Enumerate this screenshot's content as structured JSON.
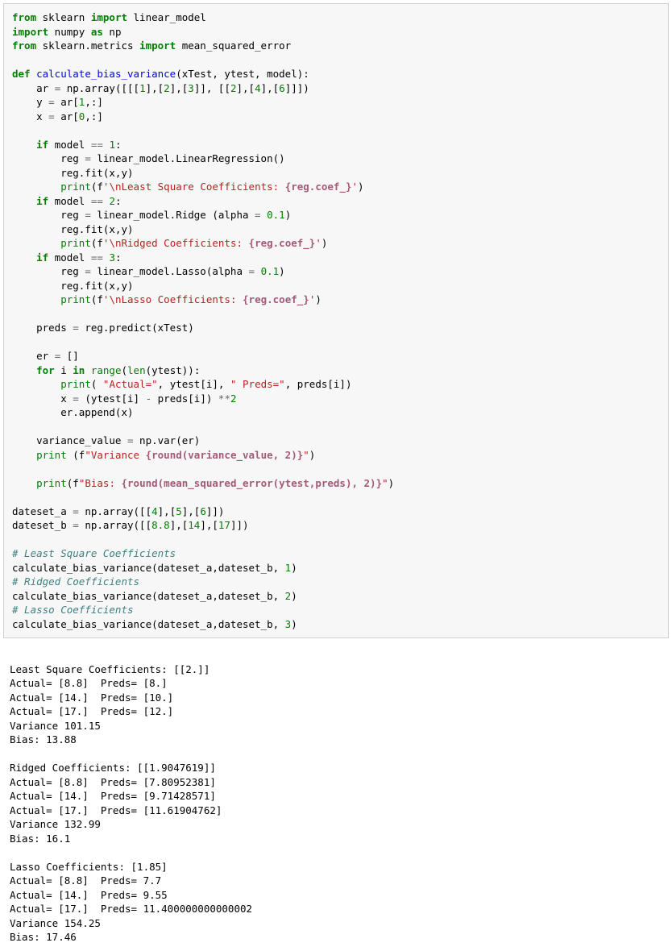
{
  "code": {
    "lines": [
      [
        [
          "kw",
          "from"
        ],
        [
          "n",
          " sklearn "
        ],
        [
          "kw",
          "import"
        ],
        [
          "n",
          " linear_model"
        ]
      ],
      [
        [
          "kw",
          "import"
        ],
        [
          "n",
          " numpy "
        ],
        [
          "kw",
          "as"
        ],
        [
          "n",
          " np"
        ]
      ],
      [
        [
          "kw",
          "from"
        ],
        [
          "n",
          " sklearn.metrics "
        ],
        [
          "kw",
          "import"
        ],
        [
          "n",
          " mean_squared_error"
        ]
      ],
      [],
      [
        [
          "kw",
          "def"
        ],
        [
          "n",
          " "
        ],
        [
          "fn",
          "calculate_bias_variance"
        ],
        [
          "n",
          "(xTest, ytest, model):"
        ]
      ],
      [
        [
          "n",
          "    ar "
        ],
        [
          "op",
          "="
        ],
        [
          "n",
          " np.array([[["
        ],
        [
          "num",
          "1"
        ],
        [
          "n",
          "],["
        ],
        [
          "num",
          "2"
        ],
        [
          "n",
          "],["
        ],
        [
          "num",
          "3"
        ],
        [
          "n",
          "]], [["
        ],
        [
          "num",
          "2"
        ],
        [
          "n",
          "],["
        ],
        [
          "num",
          "4"
        ],
        [
          "n",
          "],["
        ],
        [
          "num",
          "6"
        ],
        [
          "n",
          "]]])"
        ]
      ],
      [
        [
          "n",
          "    y "
        ],
        [
          "op",
          "="
        ],
        [
          "n",
          " ar["
        ],
        [
          "num",
          "1"
        ],
        [
          "n",
          ",:]"
        ]
      ],
      [
        [
          "n",
          "    x "
        ],
        [
          "op",
          "="
        ],
        [
          "n",
          " ar["
        ],
        [
          "num",
          "0"
        ],
        [
          "n",
          ",:]"
        ]
      ],
      [],
      [
        [
          "n",
          "    "
        ],
        [
          "kw",
          "if"
        ],
        [
          "n",
          " model "
        ],
        [
          "op",
          "=="
        ],
        [
          "n",
          " "
        ],
        [
          "num",
          "1"
        ],
        [
          "n",
          ":"
        ]
      ],
      [
        [
          "n",
          "        reg "
        ],
        [
          "op",
          "="
        ],
        [
          "n",
          " linear_model.LinearRegression()"
        ]
      ],
      [
        [
          "n",
          "        reg.fit(x,y)"
        ]
      ],
      [
        [
          "n",
          "        "
        ],
        [
          "bn",
          "print"
        ],
        [
          "n",
          "(f"
        ],
        [
          "s",
          "'\\nLeast Square Coefficients: "
        ],
        [
          "si",
          "{reg.coef_}"
        ],
        [
          "s",
          "'"
        ],
        [
          "n",
          ")"
        ]
      ],
      [
        [
          "n",
          "    "
        ],
        [
          "kw",
          "if"
        ],
        [
          "n",
          " model "
        ],
        [
          "op",
          "=="
        ],
        [
          "n",
          " "
        ],
        [
          "num",
          "2"
        ],
        [
          "n",
          ":"
        ]
      ],
      [
        [
          "n",
          "        reg "
        ],
        [
          "op",
          "="
        ],
        [
          "n",
          " linear_model.Ridge (alpha "
        ],
        [
          "op",
          "="
        ],
        [
          "n",
          " "
        ],
        [
          "num",
          "0.1"
        ],
        [
          "n",
          ")"
        ]
      ],
      [
        [
          "n",
          "        reg.fit(x,y)"
        ]
      ],
      [
        [
          "n",
          "        "
        ],
        [
          "bn",
          "print"
        ],
        [
          "n",
          "(f"
        ],
        [
          "s",
          "'\\nRidged Coefficients: "
        ],
        [
          "si",
          "{reg.coef_}"
        ],
        [
          "s",
          "'"
        ],
        [
          "n",
          ")"
        ]
      ],
      [
        [
          "n",
          "    "
        ],
        [
          "kw",
          "if"
        ],
        [
          "n",
          " model "
        ],
        [
          "op",
          "=="
        ],
        [
          "n",
          " "
        ],
        [
          "num",
          "3"
        ],
        [
          "n",
          ":"
        ]
      ],
      [
        [
          "n",
          "        reg "
        ],
        [
          "op",
          "="
        ],
        [
          "n",
          " linear_model.Lasso(alpha "
        ],
        [
          "op",
          "="
        ],
        [
          "n",
          " "
        ],
        [
          "num",
          "0.1"
        ],
        [
          "n",
          ")"
        ]
      ],
      [
        [
          "n",
          "        reg.fit(x,y)"
        ]
      ],
      [
        [
          "n",
          "        "
        ],
        [
          "bn",
          "print"
        ],
        [
          "n",
          "(f"
        ],
        [
          "s",
          "'\\nLasso Coefficients: "
        ],
        [
          "si",
          "{reg.coef_}"
        ],
        [
          "s",
          "'"
        ],
        [
          "n",
          ")"
        ]
      ],
      [],
      [
        [
          "n",
          "    preds "
        ],
        [
          "op",
          "="
        ],
        [
          "n",
          " reg.predict(xTest)"
        ]
      ],
      [],
      [
        [
          "n",
          "    er "
        ],
        [
          "op",
          "="
        ],
        [
          "n",
          " []"
        ]
      ],
      [
        [
          "n",
          "    "
        ],
        [
          "kw",
          "for"
        ],
        [
          "n",
          " i "
        ],
        [
          "kw",
          "in"
        ],
        [
          "n",
          " "
        ],
        [
          "bn",
          "range"
        ],
        [
          "n",
          "("
        ],
        [
          "bn",
          "len"
        ],
        [
          "n",
          "(ytest)):"
        ]
      ],
      [
        [
          "n",
          "        "
        ],
        [
          "bn",
          "print"
        ],
        [
          "n",
          "( "
        ],
        [
          "s",
          "\"Actual=\""
        ],
        [
          "n",
          ", ytest[i], "
        ],
        [
          "s",
          "\" Preds=\""
        ],
        [
          "n",
          ", preds[i])"
        ]
      ],
      [
        [
          "n",
          "        x "
        ],
        [
          "op",
          "="
        ],
        [
          "n",
          " (ytest[i] "
        ],
        [
          "op",
          "-"
        ],
        [
          "n",
          " preds[i]) "
        ],
        [
          "op",
          "**"
        ],
        [
          "num",
          "2"
        ]
      ],
      [
        [
          "n",
          "        er.append(x)"
        ]
      ],
      [],
      [
        [
          "n",
          "    variance_value "
        ],
        [
          "op",
          "="
        ],
        [
          "n",
          " np.var(er)"
        ]
      ],
      [
        [
          "n",
          "    "
        ],
        [
          "bn",
          "print"
        ],
        [
          "n",
          " (f"
        ],
        [
          "s",
          "\"Variance "
        ],
        [
          "si",
          "{round(variance_value, 2)}"
        ],
        [
          "s",
          "\""
        ],
        [
          "n",
          ")"
        ]
      ],
      [],
      [
        [
          "n",
          "    "
        ],
        [
          "bn",
          "print"
        ],
        [
          "n",
          "(f"
        ],
        [
          "s",
          "\"Bias: "
        ],
        [
          "si",
          "{round(mean_squared_error(ytest,preds), 2)}"
        ],
        [
          "s",
          "\""
        ],
        [
          "n",
          ")"
        ]
      ],
      [],
      [
        [
          "n",
          "dateset_a "
        ],
        [
          "op",
          "="
        ],
        [
          "n",
          " np.array([["
        ],
        [
          "num",
          "4"
        ],
        [
          "n",
          "],["
        ],
        [
          "num",
          "5"
        ],
        [
          "n",
          "],["
        ],
        [
          "num",
          "6"
        ],
        [
          "n",
          "]])"
        ]
      ],
      [
        [
          "n",
          "dateset_b "
        ],
        [
          "op",
          "="
        ],
        [
          "n",
          " np.array([["
        ],
        [
          "num",
          "8.8"
        ],
        [
          "n",
          "],["
        ],
        [
          "num",
          "14"
        ],
        [
          "n",
          "],["
        ],
        [
          "num",
          "17"
        ],
        [
          "n",
          "]])"
        ]
      ],
      [],
      [
        [
          "c",
          "# Least Square Coefficients"
        ]
      ],
      [
        [
          "n",
          "calculate_bias_variance(dateset_a,dateset_b, "
        ],
        [
          "num",
          "1"
        ],
        [
          "n",
          ")"
        ]
      ],
      [
        [
          "c",
          "# Ridged Coefficients"
        ]
      ],
      [
        [
          "n",
          "calculate_bias_variance(dateset_a,dateset_b, "
        ],
        [
          "num",
          "2"
        ],
        [
          "n",
          ")"
        ]
      ],
      [
        [
          "c",
          "# Lasso Coefficients"
        ]
      ],
      [
        [
          "n",
          "calculate_bias_variance(dateset_a,dateset_b, "
        ],
        [
          "num",
          "3"
        ],
        [
          "n",
          ")"
        ]
      ]
    ]
  },
  "output": {
    "lines": [
      "",
      "Least Square Coefficients: [[2.]]",
      "Actual= [8.8]  Preds= [8.]",
      "Actual= [14.]  Preds= [10.]",
      "Actual= [17.]  Preds= [12.]",
      "Variance 101.15",
      "Bias: 13.88",
      "",
      "Ridged Coefficients: [[1.9047619]]",
      "Actual= [8.8]  Preds= [7.80952381]",
      "Actual= [14.]  Preds= [9.71428571]",
      "Actual= [17.]  Preds= [11.61904762]",
      "Variance 132.99",
      "Bias: 16.1",
      "",
      "Lasso Coefficients: [1.85]",
      "Actual= [8.8]  Preds= 7.7",
      "Actual= [14.]  Preds= 9.55",
      "Actual= [17.]  Preds= 11.400000000000002",
      "Variance 154.25",
      "Bias: 17.46"
    ]
  }
}
